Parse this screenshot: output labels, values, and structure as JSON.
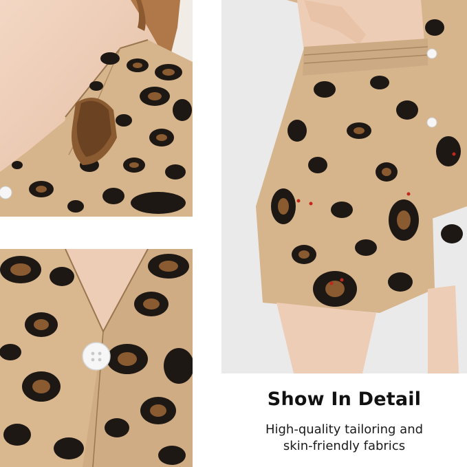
{
  "caption": {
    "title": "Show In Detail",
    "subtitle_line1": "High-quality tailoring and",
    "subtitle_line2": "skin-friendly fabrics"
  },
  "colors": {
    "fabric_base": "#d6b48c",
    "spot_dark": "#1e1814",
    "spot_fill": "#8a5a30",
    "skin": "#eecdb6",
    "background": "#ffffff",
    "button": "#f6f6f6",
    "eye_red": "#c0281c"
  },
  "panels": [
    {
      "name": "collar-closeup",
      "subject": "leopard-print satin shirt collar"
    },
    {
      "name": "button-closeup",
      "subject": "leopard-print satin shirt button placket"
    },
    {
      "name": "shorts-view",
      "subject": "leopard-print satin shorts with elastic waistband"
    }
  ]
}
